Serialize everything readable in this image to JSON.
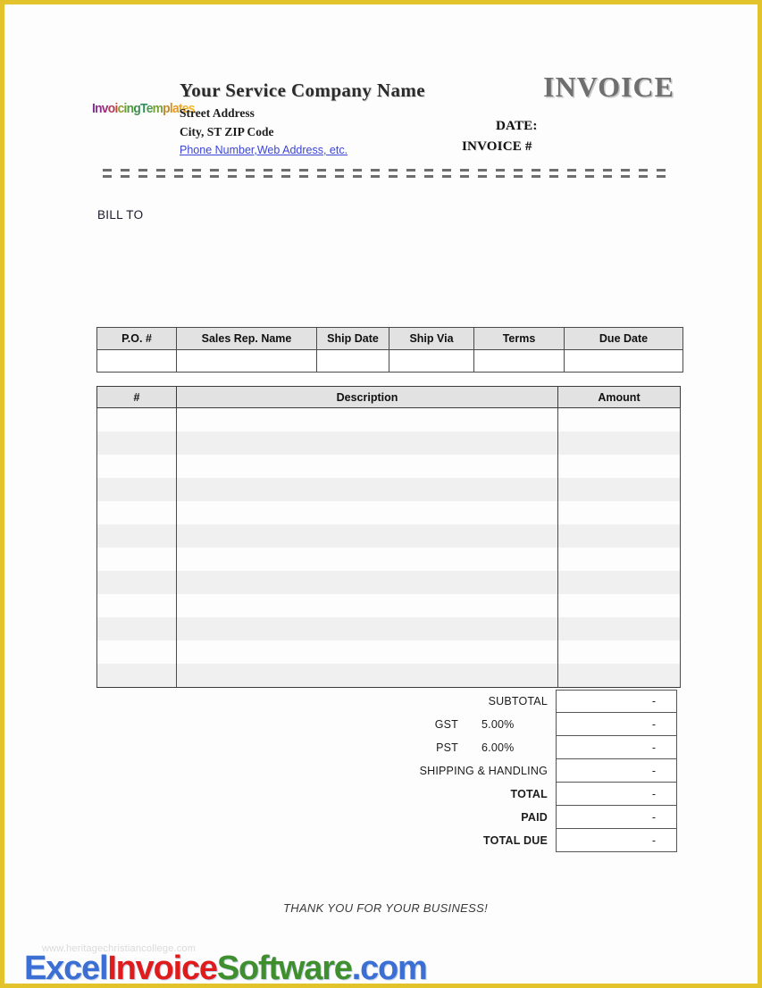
{
  "page": {
    "border_color": "#e3c32c",
    "background": "#fdfdfd"
  },
  "header": {
    "logo": {
      "name": "InvoicingTemplates",
      "parts": [
        {
          "text": "I",
          "color": "#7a2f8f"
        },
        {
          "text": "n",
          "color": "#8e2f8f"
        },
        {
          "text": "v",
          "color": "#a02f7a"
        },
        {
          "text": "o",
          "color": "#b03a5a"
        },
        {
          "text": "i",
          "color": "#c04a3a"
        },
        {
          "text": "c",
          "color": "#8f9a2f"
        },
        {
          "text": "i",
          "color": "#6f9a2f"
        },
        {
          "text": "n",
          "color": "#4f9a3f"
        },
        {
          "text": "g",
          "color": "#3f8f4f"
        },
        {
          "text": "T",
          "color": "#2f8f5f"
        },
        {
          "text": "e",
          "color": "#4f9a4f"
        },
        {
          "text": "m",
          "color": "#7aa03a"
        },
        {
          "text": "p",
          "color": "#c08a2a"
        },
        {
          "text": "l",
          "color": "#d8902a"
        },
        {
          "text": "a",
          "color": "#e09a2a"
        },
        {
          "text": "t",
          "color": "#e8a52a"
        },
        {
          "text": "e",
          "color": "#eeae2a"
        },
        {
          "text": "s",
          "color": "#f2b52a"
        }
      ]
    },
    "company_name": "Your Service Company Name",
    "address_line1": "Street Address",
    "address_line2": "City, ST  ZIP Code",
    "contact_link": "Phone Number,Web Address, etc.",
    "invoice_title": "INVOICE",
    "date_label": "DATE:",
    "invoice_number_label": "INVOICE #",
    "date_value": "",
    "invoice_number_value": ""
  },
  "bill_to": {
    "label": "BILL TO",
    "value": ""
  },
  "info_table": {
    "headers": [
      "P.O. #",
      "Sales Rep. Name",
      "Ship Date",
      "Ship Via",
      "Terms",
      "Due Date"
    ],
    "row": [
      "",
      "",
      "",
      "",
      "",
      ""
    ]
  },
  "items_table": {
    "headers": [
      "#",
      "Description",
      "Amount"
    ],
    "row_count": 12,
    "rows": [
      {
        "num": "",
        "description": "",
        "amount": ""
      },
      {
        "num": "",
        "description": "",
        "amount": ""
      },
      {
        "num": "",
        "description": "",
        "amount": ""
      },
      {
        "num": "",
        "description": "",
        "amount": ""
      },
      {
        "num": "",
        "description": "",
        "amount": ""
      },
      {
        "num": "",
        "description": "",
        "amount": ""
      },
      {
        "num": "",
        "description": "",
        "amount": ""
      },
      {
        "num": "",
        "description": "",
        "amount": ""
      },
      {
        "num": "",
        "description": "",
        "amount": ""
      },
      {
        "num": "",
        "description": "",
        "amount": ""
      },
      {
        "num": "",
        "description": "",
        "amount": ""
      },
      {
        "num": "",
        "description": "",
        "amount": ""
      }
    ]
  },
  "totals": [
    {
      "label": "SUBTOTAL",
      "rate": "",
      "value": "-",
      "bold": false
    },
    {
      "label": "GST",
      "rate": "5.00%",
      "value": "-",
      "bold": false
    },
    {
      "label": "PST",
      "rate": "6.00%",
      "value": "-",
      "bold": false
    },
    {
      "label": "SHIPPING & HANDLING",
      "rate": "",
      "value": "-",
      "bold": false
    },
    {
      "label": "TOTAL",
      "rate": "",
      "value": "-",
      "bold": true
    },
    {
      "label": "PAID",
      "rate": "",
      "value": "-",
      "bold": true
    },
    {
      "label": "TOTAL DUE",
      "rate": "",
      "value": "-",
      "bold": true
    }
  ],
  "footer": {
    "thank_you": "THANK YOU FOR YOUR BUSINESS!",
    "watermark": "www.heritagechristiancollege.com",
    "brand": {
      "excel": "Excel",
      "invoice": "Invoice",
      "software": "Software",
      "tld": ".com"
    }
  }
}
